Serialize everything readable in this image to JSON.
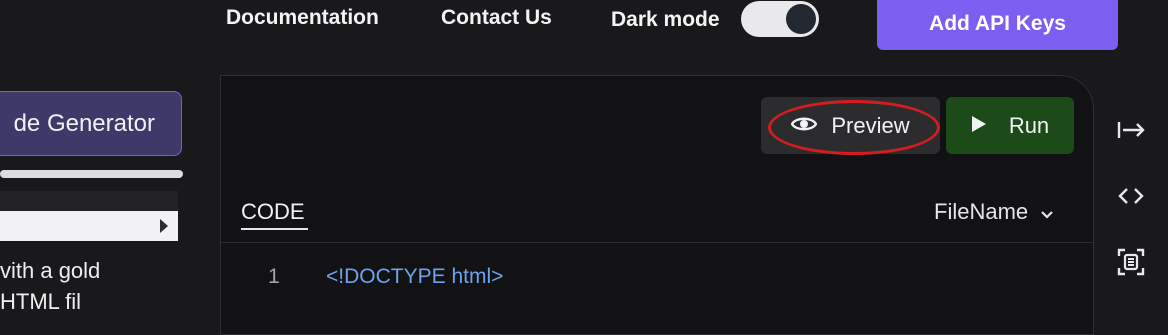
{
  "header": {
    "nav": [
      {
        "label": "Documentation"
      },
      {
        "label": "Contact Us"
      }
    ],
    "dark_mode_label": "Dark mode",
    "dark_mode_on": true,
    "api_button_label": "Add API Keys"
  },
  "sidebar": {
    "generator_button_label": "de Generator",
    "text_lines": [
      "vith a gold",
      "HTML fil"
    ]
  },
  "editor": {
    "preview_label": "Preview",
    "run_label": "Run",
    "tab_label": "CODE",
    "filename_label": "FileName",
    "lines": [
      {
        "number": "1",
        "tag": "<!DOCTYPE",
        "rest": " html>"
      }
    ]
  },
  "colors": {
    "accent": "#7c5ef0",
    "run_green": "#1d4a19",
    "annotation_red": "#d21d1d"
  },
  "icons": [
    "eye-icon",
    "play-icon",
    "chevron-down-icon",
    "collapse-panel-icon",
    "code-icon",
    "fullscreen-icon",
    "caret-right-icon"
  ]
}
